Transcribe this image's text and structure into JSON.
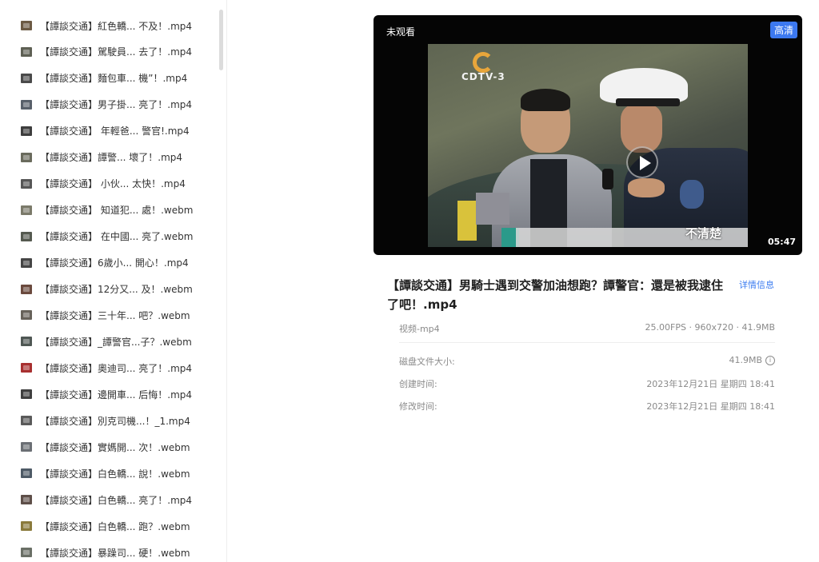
{
  "file_list": [
    {
      "label": "【譚談交通】紅色轎... 不及！.mp4",
      "color": "#6c5a44"
    },
    {
      "label": "【譚談交通】駕駛員... 去了！.mp4",
      "color": "#5e6054"
    },
    {
      "label": "【譚談交通】麵包車... 機”！.mp4",
      "color": "#4a4a4a"
    },
    {
      "label": "【譚談交通】男子掛... 亮了！.mp4",
      "color": "#58606a"
    },
    {
      "label": "【譚談交通】 年輕爸... 警官!.mp4",
      "color": "#3d3d3d"
    },
    {
      "label": "【譚談交通】譚警... 壞了！.mp4",
      "color": "#6a6b5d"
    },
    {
      "label": "【譚談交通】 小伙... 太快！.mp4",
      "color": "#565656"
    },
    {
      "label": "【譚談交通】 知道犯... 處！.webm",
      "color": "#7b7a6a"
    },
    {
      "label": "【譚談交通】 在中國... 亮了.webm",
      "color": "#555a50"
    },
    {
      "label": "【譚談交通】6歲小... 開心！.mp4",
      "color": "#454545"
    },
    {
      "label": "【譚談交通】12分又... 及！.webm",
      "color": "#6b4a3e"
    },
    {
      "label": "【譚談交通】三十年... 吧？.webm",
      "color": "#67625a"
    },
    {
      "label": "【譚談交通】_譚警官...子？.webm",
      "color": "#4f5754"
    },
    {
      "label": "【譚談交通】奧迪司... 亮了！.mp4",
      "color": "#a83030"
    },
    {
      "label": "【譚談交通】邊開車... 后悔！.mp4",
      "color": "#3f3f3f"
    },
    {
      "label": "【譚談交通】別克司機...！_1.mp4",
      "color": "#5a5a5a"
    },
    {
      "label": "【譚談交通】實媽開... 次！.webm",
      "color": "#6b6f74"
    },
    {
      "label": "【譚談交通】白色轎... 說！.webm",
      "color": "#4e5a66"
    },
    {
      "label": "【譚談交通】白色轎... 亮了！.mp4",
      "color": "#5e4f49"
    },
    {
      "label": "【譚談交通】白色轎... 跑？.webm",
      "color": "#8a7a3c"
    },
    {
      "label": "【譚談交通】暴躁司... 硬！.webm",
      "color": "#6a6f66"
    }
  ],
  "player": {
    "unwatched_label": "未观看",
    "hd_label": "高清",
    "duration": "05:47",
    "logo_text": "CDTV-3",
    "subtitle": "不清楚"
  },
  "details": {
    "title": "【譚談交通】男騎士遇到交警加油想跑？譚警官：還是被我逮住了吧！.mp4",
    "detail_link": "详情信息",
    "type_label": "视频-mp4",
    "specs": "25.00FPS · 960x720 · 41.9MB",
    "disk_size_label": "磁盘文件大小:",
    "disk_size_value": "41.9MB",
    "info_icon": "i",
    "created_label": "创建时间:",
    "created_value": "2023年12月21日 星期四 18:41",
    "modified_label": "修改时间:",
    "modified_value": "2023年12月21日 星期四 18:41"
  },
  "colors": {
    "accent": "#3c78f0"
  }
}
